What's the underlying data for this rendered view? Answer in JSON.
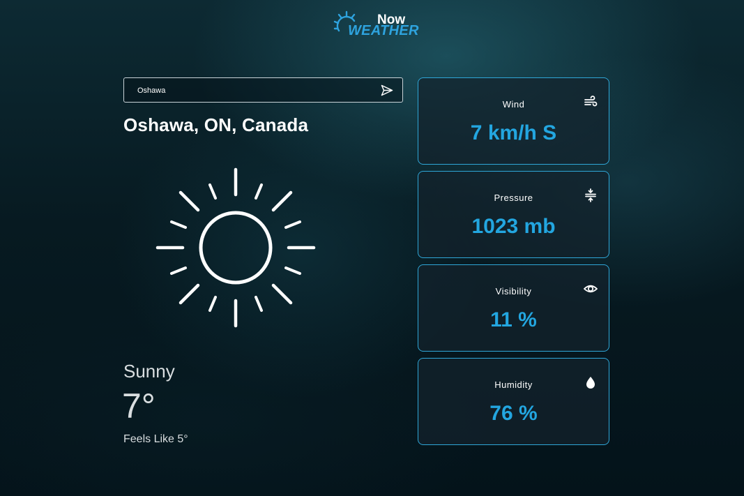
{
  "logo": {
    "now": "Now",
    "weather": "WEATHER"
  },
  "search": {
    "value": "Oshawa"
  },
  "location": "Oshawa, ON, Canada",
  "current": {
    "icon": "sun-icon",
    "condition": "Sunny",
    "temperature": "7°",
    "feels_like": "Feels Like 5°"
  },
  "cards": [
    {
      "label": "Wind",
      "value": "7 km/h S",
      "icon": "wind-icon"
    },
    {
      "label": "Pressure",
      "value": "1023 mb",
      "icon": "pressure-icon"
    },
    {
      "label": "Visibility",
      "value": "11 %",
      "icon": "eye-icon"
    },
    {
      "label": "Humidity",
      "value": "76 %",
      "icon": "droplet-icon"
    }
  ],
  "colors": {
    "accent": "#23a6e0",
    "card_border": "#2fa7d8",
    "background": "#071a21"
  }
}
